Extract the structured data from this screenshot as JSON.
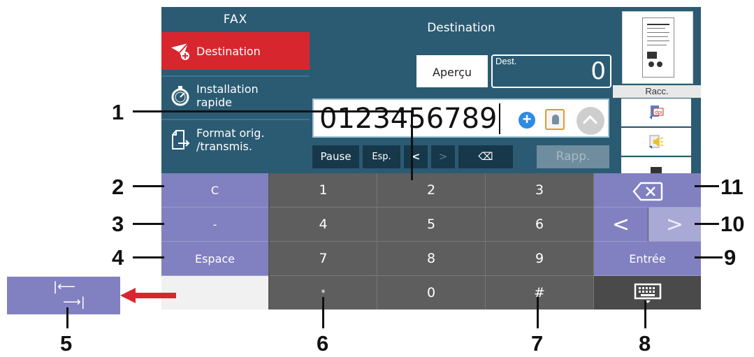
{
  "screen": {
    "fax_title": "FAX",
    "sidebar": {
      "items": [
        {
          "label": "Destination",
          "icon": "fax-send-icon",
          "active": true
        },
        {
          "label": "Installation\nrapide",
          "icon": "stopwatch-icon",
          "active": false
        },
        {
          "label": "Format orig.\n/transmis.",
          "icon": "document-format-icon",
          "active": false
        }
      ]
    },
    "destination": {
      "title": "Destination",
      "preview_label": "Aperçu",
      "dest_label": "Dest.",
      "dest_count": "0",
      "number_value": "0123456789",
      "dial_buttons": {
        "pause": "Pause",
        "space": "Esp.",
        "left": "<",
        "right": ">",
        "backspace": "⌫",
        "redial": "Rapp."
      }
    },
    "shortcuts": {
      "label": "Racc."
    },
    "keypad": {
      "rows": [
        [
          "C",
          "1",
          "2",
          "3",
          "⌫"
        ],
        [
          "-",
          "4",
          "5",
          "6",
          "<",
          ">"
        ],
        [
          "Espace",
          "7",
          "8",
          "9",
          "Entrée"
        ],
        [
          "",
          "*",
          "0",
          "#",
          "keyboard"
        ]
      ]
    }
  },
  "callouts": [
    "1",
    "2",
    "3",
    "4",
    "5",
    "6",
    "7",
    "8",
    "9",
    "10",
    "11"
  ],
  "outside_key_glyphs": {
    "top": "|⟵",
    "bottom": "⟶|"
  },
  "colors": {
    "panel_bg": "#2b5b72",
    "active_red": "#d8262f",
    "function_key": "#8180c0",
    "number_key": "#5e5e5e"
  }
}
